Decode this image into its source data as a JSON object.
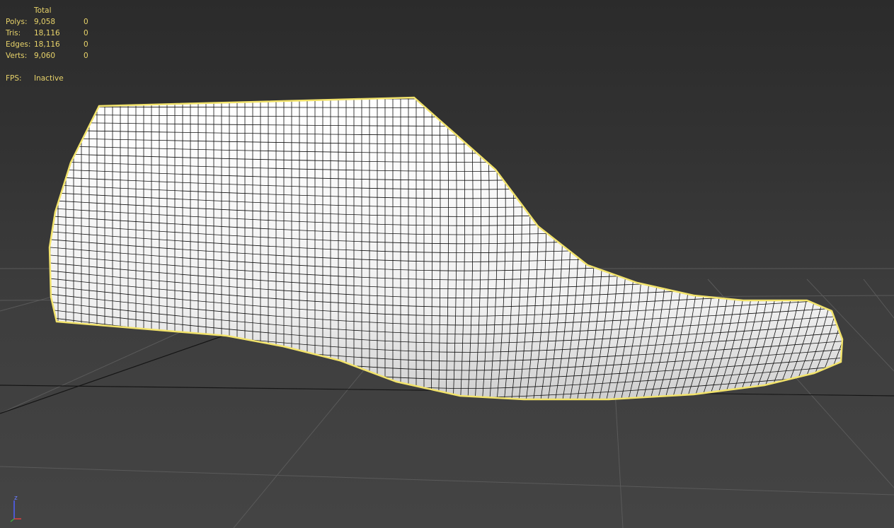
{
  "stats": {
    "header": "Total",
    "rows": [
      {
        "label": "Polys:",
        "total": "9,058",
        "selected": "0"
      },
      {
        "label": "Tris:",
        "total": "18,116",
        "selected": "0"
      },
      {
        "label": "Edges:",
        "total": "18,116",
        "selected": "0"
      },
      {
        "label": "Verts:",
        "total": "9,060",
        "selected": "0"
      }
    ],
    "fps_label": "FPS:",
    "fps_value": "Inactive"
  },
  "viewport": {
    "object": "shoe-last-mesh",
    "selection_outline_color": "#f2e36b",
    "wireframe_color": "#111111",
    "surface_color": "#f4f4f4",
    "grid_color": "#5a5a5a",
    "axis_x_color": "#e04040",
    "axis_z_color": "#5060ff"
  },
  "gizmo": {
    "z_label": "z"
  }
}
